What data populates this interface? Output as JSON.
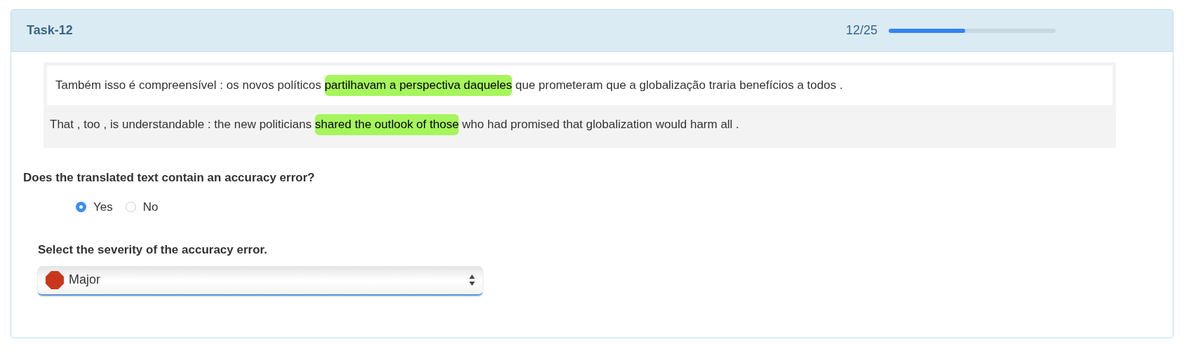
{
  "header": {
    "title": "Task-12",
    "progress_text": "12/25",
    "progress": {
      "level": 0.46
    }
  },
  "sentences": [
    {
      "kind": "source",
      "segments": [
        {
          "text": "Também isso é compreensível : os novos políticos ",
          "highlighted": false
        },
        {
          "text": "partilhavam a perspectiva daqueles",
          "highlighted": true
        },
        {
          "text": " que prometeram que a globalização traria benefícios a todos .",
          "highlighted": false
        }
      ]
    },
    {
      "kind": "target",
      "segments": [
        {
          "text": "That , too , is understandable : the new politicians ",
          "highlighted": false
        },
        {
          "text": "shared the outlook of those",
          "highlighted": true
        },
        {
          "text": " who had promised that globalization would harm all .",
          "highlighted": false
        }
      ]
    }
  ],
  "question": "Does the translated text contain an accuracy error?",
  "options": [
    {
      "label": "Yes",
      "selected": true
    },
    {
      "label": "No",
      "selected": false
    }
  ],
  "severity": {
    "label": "Select the severity of the accuracy error.",
    "value": "Major"
  }
}
